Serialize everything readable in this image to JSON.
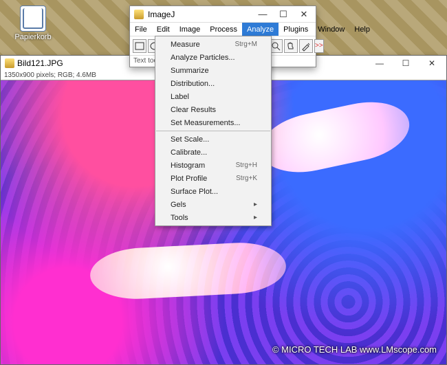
{
  "desktop": {
    "icon_label": "Papierkorb"
  },
  "image_window": {
    "title": "Bild121.JPG",
    "info": "1350x900 pixels; RGB; 4.6MB",
    "min": "—",
    "max": "☐",
    "close": "✕",
    "watermark": "© MICRO TECH LAB   www.LMscope.com"
  },
  "ij": {
    "title": "ImageJ",
    "min": "—",
    "max": "☐",
    "close": "✕",
    "menu": [
      "File",
      "Edit",
      "Image",
      "Process",
      "Analyze",
      "Plugins",
      "Window",
      "Help"
    ],
    "menu_selected": 4,
    "status": "Text tool (do",
    "tool_more": ">>",
    "tool_svg": {
      "rect": "<rect x='3' y='4' width='12' height='10' fill='none' stroke='#333'/>",
      "oval": "<ellipse cx='9' cy='9' rx='6' ry='5' fill='none' stroke='#333'/>",
      "poly": "<polygon points='3,14 6,4 14,6 12,14' fill='none' stroke='#333'/>",
      "free": "<path d='M3 13 C5 5,13 5,15 13' fill='none' stroke='#333'/>",
      "line": "<line x1='3' y1='14' x2='15' y2='4' stroke='#333'/>",
      "angle": "<path d='M4 14 L4 5 M4 14 L14 8' fill='none' stroke='#333'/>",
      "point": "<circle cx='9' cy='9' r='1.5' fill='#333'/><line x1='9' y1='3' x2='9' y2='15' stroke='#333'/><line x1='3' y1='9' x2='15' y2='9' stroke='#333'/>",
      "wand": "<path d='M4 14 L14 4 M12 3l1 1 M15 6l-1 1' stroke='#333' fill='none'/>",
      "text": "<text x='4' y='13' font-size='12' fill='#333'>A</text>",
      "zoom": "<circle cx='8' cy='8' r='4' fill='none' stroke='#333'/><line x1='11' y1='11' x2='15' y2='15' stroke='#333'/>",
      "hand": "<path d='M5 9v-3a1 1 0 012 0v-1a1 1 0 012 0v1a1 1 0 012 0v4l1 1v2H6z' fill='none' stroke='#333'/>",
      "picker": "<path d='M4 14l7-7 2 2-7 7z M12 5l2 2' fill='none' stroke='#333'/>"
    },
    "tools": [
      {
        "n": "rect",
        "k": "rect"
      },
      {
        "n": "oval",
        "k": "oval"
      },
      {
        "n": "poly",
        "k": "poly"
      },
      {
        "n": "free",
        "k": "free"
      },
      {
        "n": "line",
        "k": "line"
      },
      {
        "n": "angle",
        "k": "angle"
      },
      {
        "n": "point",
        "k": "point"
      },
      {
        "n": "wand",
        "k": "wand"
      },
      {
        "n": "text",
        "k": "text",
        "sel": true
      },
      {
        "n": "zoom",
        "k": "zoom"
      },
      {
        "n": "hand",
        "k": "hand"
      },
      {
        "n": "picker",
        "k": "picker"
      }
    ]
  },
  "dropdown": [
    {
      "label": "Measure",
      "shortcut": "Strg+M"
    },
    {
      "label": "Analyze Particles..."
    },
    {
      "label": "Summarize"
    },
    {
      "label": "Distribution..."
    },
    {
      "label": "Label"
    },
    {
      "label": "Clear Results"
    },
    {
      "label": "Set Measurements..."
    },
    {
      "sep": true
    },
    {
      "label": "Set Scale..."
    },
    {
      "label": "Calibrate..."
    },
    {
      "label": "Histogram",
      "shortcut": "Strg+H"
    },
    {
      "label": "Plot Profile",
      "shortcut": "Strg+K"
    },
    {
      "label": "Surface Plot..."
    },
    {
      "label": "Gels",
      "submenu": true
    },
    {
      "label": "Tools",
      "submenu": true
    }
  ]
}
